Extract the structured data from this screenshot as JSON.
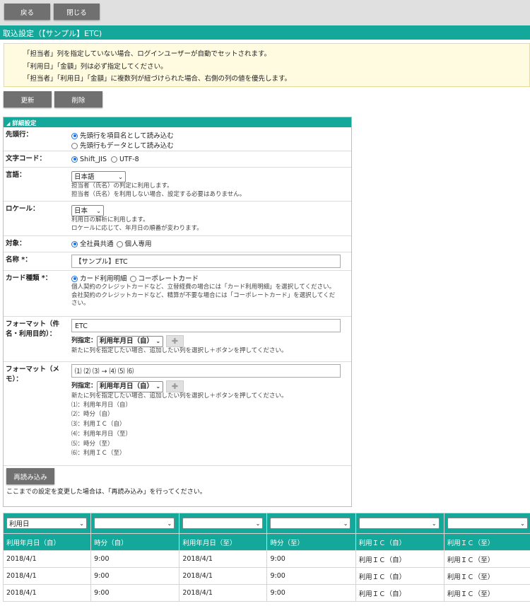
{
  "toolbar": {
    "back_label": "戻る",
    "close_label": "閉じる"
  },
  "page_title": "取込設定（【サンプル】ETC)",
  "notice": [
    "「担当者」列を指定していない場合、ログインユーザーが自動でセットされます。",
    "「利用日」「金額」列は必ず指定してください。",
    "「担当者」「利用日」「金額」に複数列が紐づけられた場合、右側の列の値を優先します。"
  ],
  "actions": {
    "update_label": "更新",
    "delete_label": "削除"
  },
  "details": {
    "header": "詳細設定",
    "header_icon": "triangle-down-icon",
    "header_row": {
      "label": "先頭行：",
      "options": [
        "先頭行を項目名として読み込む",
        "先頭行もデータとして読み込む"
      ],
      "selected": 0
    },
    "charset": {
      "label": "文字コード：",
      "options": [
        "Shift_JIS",
        "UTF-8"
      ],
      "selected": 0
    },
    "language": {
      "label": "言語：",
      "value": "日本語",
      "hints": [
        "担当者（氏名）の判定に利用します。",
        "担当者（氏名）を利用しない場合、設定する必要はありません。"
      ]
    },
    "locale": {
      "label": "ロケール：",
      "value": "日本",
      "hints": [
        "利用日の解析に利用します。",
        "ロケールに応じて、年月日の順番が変わります。"
      ]
    },
    "target": {
      "label": "対象：",
      "options": [
        "全社員共通",
        "個人専用"
      ],
      "selected": 0
    },
    "name": {
      "label": "名称 *：",
      "value": "【サンプル】ETC"
    },
    "card_type": {
      "label": "カード種類 *：",
      "options": [
        "カード利用明細",
        "コーポレートカード"
      ],
      "selected": 0,
      "hints": [
        "個人契約のクレジットカードなど、立替経費の場合には「カード利用明細」を選択してください。",
        "会社契約のクレジットカードなど、精算が不要な場合には「コーポレートカード」を選択してください。"
      ]
    },
    "format_name": {
      "label": "フォーマット（件名・利用目的）：",
      "value": "ETC",
      "column_label": "列指定：",
      "column_value": "利用年月日（自）",
      "hint": "新たに列を指定したい場合、追加したい列を選択し＋ボタンを押してください。"
    },
    "format_memo": {
      "label": "フォーマット（メモ）：",
      "value": "⑴ ⑵ ⑶ → ⑷ ⑸ ⑹",
      "column_label": "列指定：",
      "column_value": "利用年月日（自）",
      "hint": "新たに列を指定したい場合、追加したい列を選択し＋ボタンを押してください。",
      "legend": [
        "⑴：利用年月日（自）",
        "⑵：時分（自）",
        "⑶：利用ＩＣ（自）",
        "⑷：利用年月日（至）",
        "⑸：時分（至）",
        "⑹：利用ＩＣ（至）"
      ]
    },
    "reload_label": "再読み込み",
    "reload_note": "ここまでの設定を変更した場合は、「再読み込み」を行ってください。"
  },
  "grid": {
    "selectors": [
      "利用日",
      "",
      "",
      "",
      "",
      ""
    ],
    "headers": [
      "利用年月日（自）",
      "時分（自）",
      "利用年月日（至）",
      "時分（至）",
      "利用ＩＣ（自）",
      "利用ＩＣ（至）"
    ],
    "rows": [
      [
        "2018/4/1",
        "9:00",
        "2018/4/1",
        "9:00",
        "利用ＩＣ（自）",
        "利用ＩＣ（至）"
      ],
      [
        "2018/4/1",
        "9:00",
        "2018/4/1",
        "9:00",
        "利用ＩＣ（自）",
        "利用ＩＣ（至）"
      ],
      [
        "2018/4/1",
        "9:00",
        "2018/4/1",
        "9:00",
        "利用ＩＣ（自）",
        "利用ＩＣ（至）"
      ]
    ]
  },
  "colors": {
    "accent": "#14a89a",
    "button": "#707070",
    "notice_bg": "#fffbe0",
    "radio": "#1a73e8"
  }
}
